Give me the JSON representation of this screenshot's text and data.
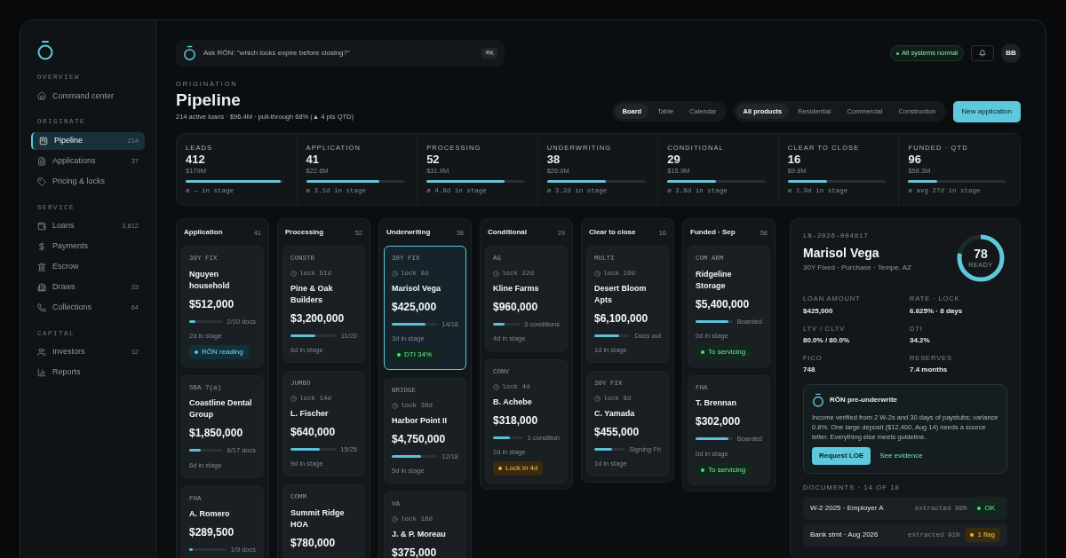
{
  "sidebar": {
    "sections": [
      {
        "title": "OVERVIEW",
        "items": [
          {
            "label": "Command center",
            "selected": false
          }
        ]
      },
      {
        "title": "ORIGINATE",
        "items": [
          {
            "label": "Pipeline",
            "count": "214",
            "selected": true
          },
          {
            "label": "Applications",
            "count": "37",
            "selected": false
          },
          {
            "label": "Pricing & locks",
            "selected": false
          }
        ]
      },
      {
        "title": "SERVICE",
        "items": [
          {
            "label": "Loans",
            "count": "3,812",
            "selected": false
          },
          {
            "label": "Payments",
            "selected": false
          },
          {
            "label": "Escrow",
            "selected": false
          },
          {
            "label": "Draws",
            "count": "33",
            "selected": false
          },
          {
            "label": "Collections",
            "count": "64",
            "selected": false
          }
        ]
      },
      {
        "title": "CAPITAL",
        "items": [
          {
            "label": "Investors",
            "count": "12",
            "selected": false
          },
          {
            "label": "Reports",
            "selected": false
          }
        ]
      }
    ]
  },
  "topbar": {
    "search_placeholder": "Ask RŌN: \"which locks expire before closing?\"",
    "shortcut": "⌘K",
    "status": "All systems normal",
    "avatar": "BB"
  },
  "header": {
    "eyebrow": "ORIGINATION",
    "title": "Pipeline",
    "subtitle": "214 active loans · $96.4M · pull-through 68% (▲ 4 pts QTD)",
    "views": [
      {
        "label": "Board",
        "selected": true
      },
      {
        "label": "Table",
        "selected": false
      },
      {
        "label": "Calendar",
        "selected": false
      }
    ],
    "filters": [
      {
        "label": "All products",
        "selected": true
      },
      {
        "label": "Residential",
        "selected": false
      },
      {
        "label": "Commercial",
        "selected": false
      },
      {
        "label": "Construction",
        "selected": false
      }
    ],
    "primary_button": "New application"
  },
  "stats": [
    {
      "label": "LEADS",
      "value": "412",
      "amount": "$179M",
      "level": 0.97,
      "note": "ø — in stage"
    },
    {
      "label": "APPLICATION",
      "value": "41",
      "amount": "$22.6M",
      "level": 0.75,
      "note": "ø 3.1d in stage"
    },
    {
      "label": "PROCESSING",
      "value": "52",
      "amount": "$31.9M",
      "level": 0.8,
      "note": "ø 4.9d in stage"
    },
    {
      "label": "UNDERWRITING",
      "value": "38",
      "amount": "$26.0M",
      "level": 0.6,
      "note": "ø 3.2d in stage"
    },
    {
      "label": "CONDITIONAL",
      "value": "29",
      "amount": "$15.9M",
      "level": 0.5,
      "note": "ø 2.8d in stage"
    },
    {
      "label": "CLEAR TO CLOSE",
      "value": "16",
      "amount": "$9.8M",
      "level": 0.4,
      "note": "ø 1.9d in stage"
    },
    {
      "label": "FUNDED · QTD",
      "value": "96",
      "amount": "$58.3M",
      "level": 0.3,
      "note": "ø avg 27d in stage"
    }
  ],
  "board": [
    {
      "title": "Application",
      "count": "41",
      "cards": [
        {
          "type": "30Y FIX",
          "name": "Nguyen household",
          "amount": "$512,000",
          "level": 0.2,
          "progress": "2/10 docs",
          "stage": "2d in stage",
          "tag": {
            "text": "RŌN reading",
            "kind": "info"
          },
          "selected": false
        },
        {
          "type": "SBA 7(a)",
          "name": "Coastline Dental Group",
          "amount": "$1,850,000",
          "level": 0.35,
          "progress": "6/17 docs",
          "stage": "6d in stage",
          "selected": false
        },
        {
          "type": "FHA",
          "name": "A. Romero",
          "amount": "$289,500",
          "level": 0.1,
          "progress": "1/9 docs",
          "selected": false
        }
      ]
    },
    {
      "title": "Processing",
      "count": "52",
      "cards": [
        {
          "type": "CONSTR",
          "lock": "lock 51d",
          "name": "Pine & Oak Builders",
          "amount": "$3,200,000",
          "level": 0.55,
          "progress": "11/20",
          "stage": "6d in stage",
          "selected": false
        },
        {
          "type": "JUMBO",
          "lock": "lock 14d",
          "name": "L. Fischer",
          "amount": "$640,000",
          "level": 0.65,
          "progress": "15/25",
          "stage": "9d in stage",
          "selected": false
        },
        {
          "type": "COMM",
          "name": "Summit Ridge HOA",
          "amount": "$780,000",
          "selected": false
        }
      ]
    },
    {
      "title": "Underwriting",
      "count": "38",
      "cards": [
        {
          "type": "30Y FIX",
          "lock": "lock 8d",
          "name": "Marisol Vega",
          "amount": "$425,000",
          "level": 0.75,
          "progress": "14/18",
          "stage": "3d in stage",
          "tag": {
            "text": "DTI 34%",
            "kind": "ok"
          },
          "selected": true
        },
        {
          "type": "BRIDGE",
          "lock": "lock 30d",
          "name": "Harbor Point II",
          "amount": "$4,750,000",
          "level": 0.65,
          "progress": "12/18",
          "stage": "5d in stage",
          "selected": false
        },
        {
          "type": "VA",
          "lock": "lock 18d",
          "name": "J. & P. Moreau",
          "amount": "$375,000",
          "selected": false
        }
      ]
    },
    {
      "title": "Conditional",
      "count": "29",
      "cards": [
        {
          "type": "AG",
          "lock": "lock 22d",
          "name": "Kline Farms",
          "amount": "$960,000",
          "level": 0.45,
          "progress": "3 conditions",
          "stage": "4d in stage",
          "selected": false
        },
        {
          "type": "CONV",
          "lock": "lock 4d",
          "name": "B. Achebe",
          "amount": "$318,000",
          "level": 0.55,
          "progress": "1 condition",
          "stage": "2d in stage",
          "tag": {
            "text": "Lock in 4d",
            "kind": "warn"
          },
          "selected": false
        }
      ]
    },
    {
      "title": "Clear to close",
      "count": "16",
      "cards": [
        {
          "type": "MULTI",
          "lock": "lock 19d",
          "name": "Desert Bloom Apts",
          "amount": "$6,100,000",
          "level": 0.7,
          "progress": "Docs out",
          "stage": "1d in stage",
          "selected": false
        },
        {
          "type": "30Y FIX",
          "lock": "lock 9d",
          "name": "C. Yamada",
          "amount": "$455,000",
          "level": 0.6,
          "progress": "Signing Fri",
          "stage": "1d in stage",
          "selected": false
        }
      ]
    },
    {
      "title": "Funded · Sep",
      "count": "58",
      "cards": [
        {
          "type": "COM ARM",
          "name": "Ridgeline Storage",
          "amount": "$5,400,000",
          "level": 0.9,
          "progress": "Boarded",
          "stage": "0d in stage",
          "tag": {
            "text": "To servicing",
            "kind": "ok"
          },
          "selected": false
        },
        {
          "type": "FHA",
          "name": "T. Brennan",
          "amount": "$302,000",
          "level": 0.9,
          "progress": "Boarded",
          "stage": "0d in stage",
          "tag": {
            "text": "To servicing",
            "kind": "ok"
          },
          "selected": false
        }
      ]
    }
  ],
  "detail": {
    "loan_id": "LN-2026-004817",
    "name": "Marisol Vega",
    "summary": "30Y Fixed · Purchase · Tempe, AZ",
    "score": {
      "value": "78",
      "label": "READY",
      "level": 0.78
    },
    "fields": [
      {
        "label": "LOAN AMOUNT",
        "value": "$425,000"
      },
      {
        "label": "RATE · LOCK",
        "value": "6.625% · 8 days"
      },
      {
        "label": "LTV / CLTV",
        "value": "80.0% / 80.0%"
      },
      {
        "label": "DTI",
        "value": "34.2%"
      },
      {
        "label": "FICO",
        "value": "748"
      },
      {
        "label": "RESERVES",
        "value": "7.4 months"
      }
    ],
    "ai": {
      "title": "RŌN pre-underwrite",
      "text": "Income verified from 2 W-2s and 30 days of paystubs; variance 0.8%. One large deposit ($12,400, Aug 14) needs a source letter. Everything else meets guideline.",
      "primary": "Request LOE",
      "secondary": "See evidence"
    },
    "documents_title": "DOCUMENTS · 14 OF 18",
    "documents": [
      {
        "name": "W-2 2025 · Employer A",
        "extracted": "extracted 98%",
        "status": {
          "text": "OK",
          "kind": "ok"
        }
      },
      {
        "name": "Bank stmt · Aug 2026",
        "extracted": "extracted 91%",
        "status": {
          "text": "1 flag",
          "kind": "warn"
        }
      }
    ]
  }
}
